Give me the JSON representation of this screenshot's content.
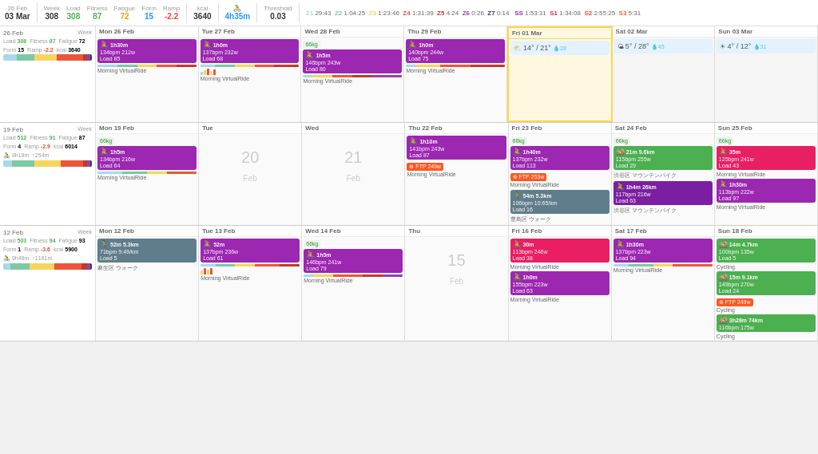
{
  "header": {
    "date_range": "26 Feb 03 Mar",
    "week_label": "Week",
    "load_label": "Load",
    "load_val": "308",
    "fitness_label": "Fitness",
    "fitness_val": "87",
    "fatigue_label": "Fatigue",
    "fatigue_val": "72",
    "form_label": "Form",
    "form_val": "15",
    "ramp_label": "Ramp",
    "ramp_val": "-2.2",
    "kcal_label": "kcal",
    "kcal_val": "3640",
    "duration_label": "4h35m",
    "threshold_label": "Threshold",
    "threshold_val": "0.03",
    "z1_val": "29:43",
    "z2_val": "1:04:25",
    "z3_val": "1:23:46",
    "z4_val": "1:31:39",
    "z5_val": "4:24",
    "z6_val": "0:26",
    "z7_val": "0:14",
    "ss_val": "1:53:31",
    "s1_val": "1:34:08",
    "s2_val": "2:55:25",
    "s3_val": "5:31"
  },
  "weeks": [
    {
      "label": "26 Feb 03 Mar",
      "week_num": "Week",
      "load": "308",
      "fitness": "87",
      "fatigue": "72",
      "form": "15",
      "ramp": "-2.2",
      "kcal": "3640",
      "days": [
        {
          "name": "Mon 26 Feb",
          "short_name": "Mon",
          "date_num": "26",
          "month": "Feb",
          "activities": [
            {
              "type": "ride",
              "duration": "1h30m",
              "bpm": "134bpm",
              "watts": "212w",
              "load": "Load 85",
              "name": "Morning VirtualRide"
            }
          ]
        },
        {
          "name": "Tue 27 Feb",
          "short_name": "Tue",
          "date_num": "27",
          "month": "Feb",
          "activities": [
            {
              "type": "ride",
              "duration": "1h0m",
              "bpm": "137bpm",
              "watts": "232w",
              "load": "Load 68",
              "name": "Morning VirtualRide"
            }
          ]
        },
        {
          "name": "Wed 28 Feb",
          "short_name": "Wed",
          "date_num": "28",
          "month": "Feb",
          "activities": [
            {
              "type": "ride",
              "duration": "1h5m",
              "bpm": "146bpm",
              "watts": "243w",
              "load": "Load 80",
              "name": "Morning VirtualRide"
            }
          ]
        },
        {
          "name": "Thu 29 Feb",
          "short_name": "Thu",
          "date_num": "29",
          "month": "Feb",
          "activities": [
            {
              "type": "ride",
              "duration": "1h0m",
              "bpm": "140bpm",
              "watts": "244w",
              "load": "Load 75",
              "name": "Morning VirtualRide"
            }
          ]
        },
        {
          "name": "Fri 01 Mar",
          "short_name": "Fri",
          "date_num": "01",
          "month": "Mar",
          "is_today": true,
          "weather": {
            "icon": "partly",
            "high": "21",
            "low": "14",
            "rain": "28"
          },
          "activities": []
        },
        {
          "name": "Sat 02 Mar",
          "short_name": "Sat",
          "date_num": "02",
          "month": "Mar",
          "is_future": true,
          "weather": {
            "icon": "cloud",
            "high": "28",
            "low": "5",
            "rain": "45"
          },
          "activities": []
        },
        {
          "name": "Sun 03 Mar",
          "short_name": "Sun",
          "date_num": "03",
          "month": "Mar",
          "is_future": true,
          "weather": {
            "icon": "sun",
            "high": "12",
            "low": "4",
            "rain": "31"
          },
          "activities": []
        }
      ]
    },
    {
      "label": "19 Feb - 25 Feb",
      "load": "512",
      "fitness": "91",
      "fatigue": "87",
      "form": "4",
      "ramp": "-2.9",
      "kcal": "6014",
      "moving": "8h19m",
      "up": "254m",
      "days": [
        {
          "name": "Mon 19 Feb",
          "short_name": "Mon",
          "date_num": "19",
          "month": "Feb",
          "activities": [
            {
              "type": "ride",
              "duration": "1h5m",
              "bpm": "134bpm",
              "watts": "216w",
              "load": "Load 64",
              "name": "Morning VirtualRide"
            }
          ]
        },
        {
          "name": "Tue 20 Feb",
          "short_name": "Tue",
          "date_num": "20",
          "month": "Feb",
          "activities": []
        },
        {
          "name": "Wed 21 Feb",
          "short_name": "Wed",
          "date_num": "21",
          "month": "Feb",
          "activities": []
        },
        {
          "name": "Thu 22 Feb",
          "short_name": "Thu",
          "date_num": "22",
          "month": "Feb",
          "activities": [
            {
              "type": "ride",
              "duration": "1h10m",
              "bpm": "141bpm",
              "watts": "243w",
              "load": "Load 87",
              "ftp": "FTP 249w",
              "name": "Morning VirtualRide"
            }
          ]
        },
        {
          "name": "Fri 23 Feb",
          "short_name": "Fri",
          "date_num": "23",
          "month": "Feb",
          "activities": [
            {
              "type": "ride",
              "duration": "1h40m",
              "bpm": "137bpm",
              "watts": "232w",
              "load": "Load 113",
              "ftp": "FTP 253w",
              "name": "Morning VirtualRide"
            },
            {
              "type": "run",
              "duration": "54m",
              "distance": "5.3km",
              "bpm": "106bpm",
              "pace": "10:65/km",
              "load": "Load 16",
              "name": "豊島区 ウォーク"
            }
          ]
        },
        {
          "name": "Sat 24 Feb",
          "short_name": "Sat",
          "date_num": "24",
          "month": "Feb",
          "activities": [
            {
              "type": "ride",
              "duration": "21m",
              "distance": "9.6km",
              "bpm": "115bpm",
              "watts": "255w",
              "load": "Load 29",
              "name": "渋谷区 マウンテンバイク"
            },
            {
              "type": "ride",
              "duration": "1h4m",
              "distance": "26km",
              "bpm": "117bpm",
              "watts": "216w",
              "load": "Load 63",
              "name": "渋谷区 マウンテンバイク"
            }
          ]
        },
        {
          "name": "Sun 25 Feb",
          "short_name": "Sun",
          "date_num": "25",
          "month": "Feb",
          "activities": [
            {
              "type": "ride",
              "duration": "35m",
              "bpm": "125bpm",
              "watts": "241w",
              "load": "Load 43",
              "name": "Morning VirtualRide"
            },
            {
              "type": "ride",
              "duration": "1h30m",
              "bpm": "113bpm",
              "watts": "222w",
              "load": "Load 97",
              "name": "Morning VirtualRide"
            }
          ]
        }
      ]
    },
    {
      "label": "12 Feb - 18 Feb",
      "load": "503",
      "fitness": "94",
      "fatigue": "93",
      "form": "1",
      "ramp": "-3.6",
      "kcal": "5900",
      "moving": "9h48m",
      "up": "1161m",
      "days": [
        {
          "name": "Mon 12 Feb",
          "short_name": "Mon",
          "date_num": "12",
          "month": "Feb",
          "activities": [
            {
              "type": "run",
              "duration": "52m",
              "distance": "5.3km",
              "bpm": "71bpm",
              "pace": "9:49/km",
              "load": "Load 5",
              "name": "麻生区 ウォーク"
            }
          ]
        },
        {
          "name": "Tue 13 Feb",
          "short_name": "Tue",
          "date_num": "13",
          "month": "Feb",
          "activities": [
            {
              "type": "ride",
              "duration": "52m",
              "bpm": "137bpm",
              "watts": "236w",
              "load": "Load 61",
              "name": "Morning VirtualRide"
            }
          ]
        },
        {
          "name": "Wed 14 Feb",
          "short_name": "Wed",
          "date_num": "14",
          "month": "Feb",
          "activities": [
            {
              "type": "ride",
              "duration": "1h5m",
              "bpm": "146bpm",
              "watts": "241w",
              "load": "Load 79",
              "name": "Morning VirtualRide"
            }
          ]
        },
        {
          "name": "Thu 15 Feb",
          "short_name": "Thu",
          "date_num": "15",
          "month": "Feb",
          "activities": []
        },
        {
          "name": "Fri 16 Feb",
          "short_name": "Fri",
          "date_num": "16",
          "month": "Feb",
          "activities": [
            {
              "type": "ride",
              "duration": "30m",
              "bpm": "113bpm",
              "watts": "246w",
              "load": "Load 38",
              "name": "Morning VirtualRide"
            },
            {
              "type": "ride",
              "duration": "1h0m",
              "bpm": "155bpm",
              "watts": "223w",
              "load": "Load 63",
              "name": "Morning VirtualRide"
            }
          ]
        },
        {
          "name": "Sat 17 Feb",
          "short_name": "Sat",
          "date_num": "17",
          "month": "Feb",
          "activities": [
            {
              "type": "ride",
              "duration": "1h30m",
              "bpm": "137bpm",
              "watts": "223w",
              "load": "Load 94",
              "name": "Morning VirtualRide"
            }
          ]
        },
        {
          "name": "Sun 18 Feb",
          "short_name": "Sun",
          "date_num": "18",
          "month": "Feb",
          "activities": [
            {
              "type": "bike-outdoor",
              "duration": "14m",
              "distance": "4.7km",
              "bpm": "100bpm",
              "watts": "135w",
              "load": "Load 5",
              "name": "Cycling"
            },
            {
              "type": "bike-outdoor",
              "duration": "15m",
              "distance": "9.1km",
              "bpm": "149bpm",
              "watts": "270w",
              "load": "Load 24",
              "name": "Cycling",
              "ftp": "FTP 249w"
            },
            {
              "type": "bike-outdoor",
              "duration": "3h28m",
              "distance": "74km",
              "bpm": "116bpm",
              "watts": "175w",
              "name": "Cycling"
            }
          ]
        }
      ]
    }
  ]
}
